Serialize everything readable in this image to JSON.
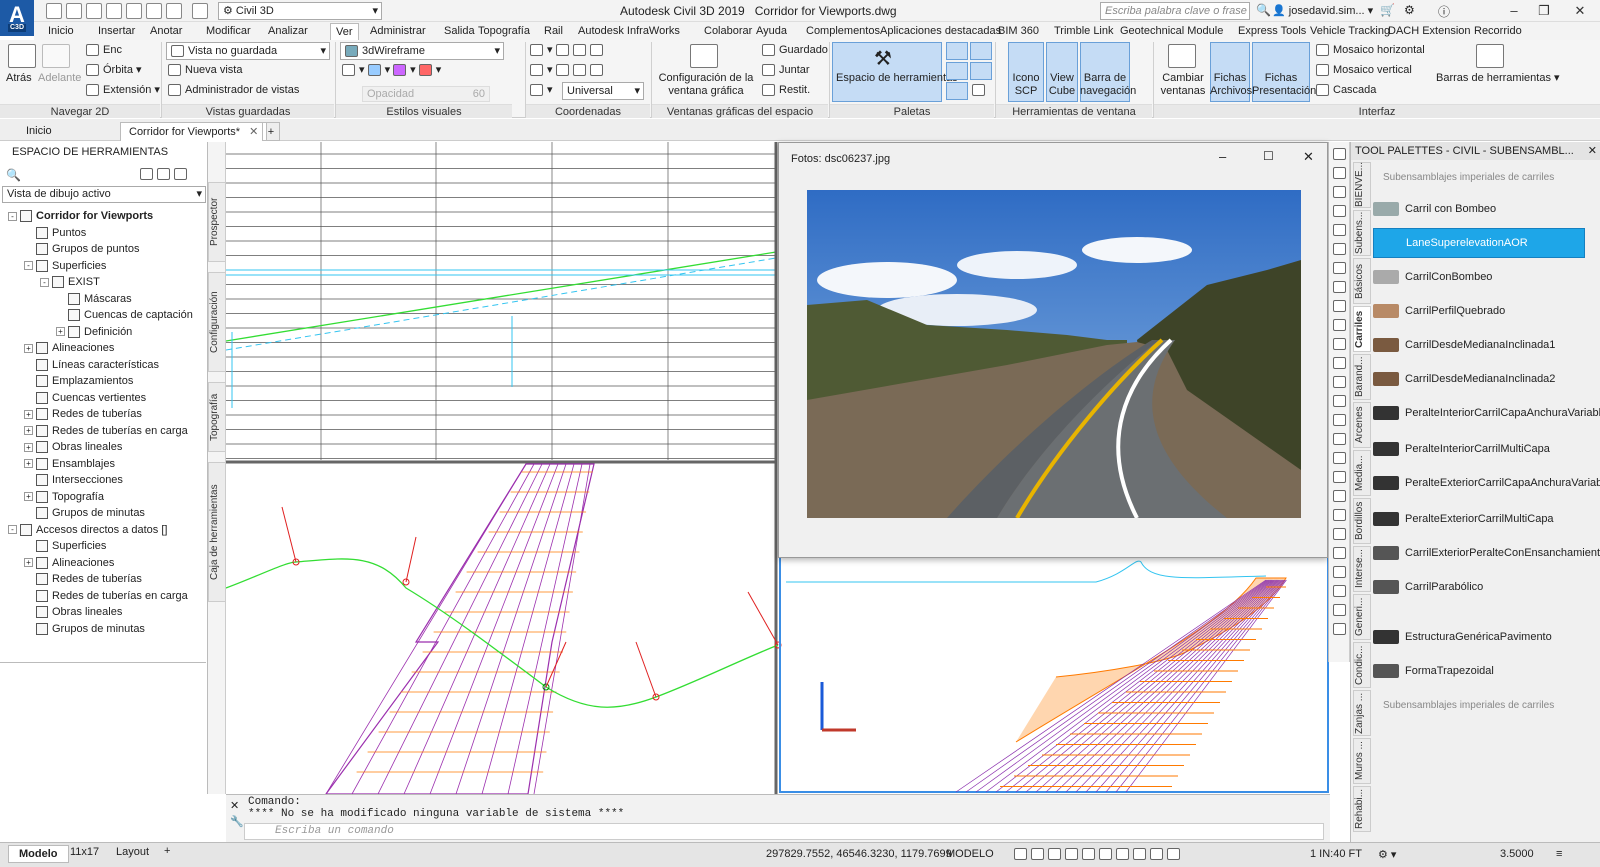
{
  "app": {
    "logo_text": "A",
    "logo_sub": "C3D",
    "title": "Autodesk Civil 3D 2019",
    "file": "Corridor for Viewports.dwg",
    "workspace": "Civil 3D",
    "search_placeholder": "Escriba palabra clave o frase",
    "user": "josedavid.sim..."
  },
  "ribbon_tabs": [
    "Inicio",
    "Insertar",
    "Anotar",
    "Modificar",
    "Analizar",
    "Ver",
    "Administrar",
    "Salida",
    "Topografía",
    "Rail",
    "Autodesk InfraWorks",
    "Colaborar",
    "Ayuda",
    "Complementos",
    "Aplicaciones destacadas",
    "BIM 360",
    "Trimble Link",
    "Geotechnical Module",
    "Express Tools",
    "Vehicle Tracking",
    "DACH Extension",
    "Recorrido"
  ],
  "active_tab": "Ver",
  "ribbon": {
    "nav": {
      "atras": "Atrás",
      "adelante": "Adelante",
      "enc": "Enc",
      "orbita": "Órbita",
      "extension": "Extensión",
      "title": "Navegar 2D"
    },
    "views": {
      "dropdown": "Vista no guardada",
      "nueva": "Nueva vista",
      "admin": "Administrador de vistas",
      "title": "Vistas guardadas"
    },
    "visual": {
      "dropdown": "3dWireframe",
      "opacity_label": "Opacidad",
      "opacity_value": "60",
      "title": "Estilos visuales"
    },
    "coords": {
      "dropdown": "Universal",
      "title": "Coordenadas"
    },
    "viewports": {
      "config": "Configuración de la ventana gráfica",
      "guardado": "Guardado",
      "juntar": "Juntar",
      "restit": "Restit.",
      "title": "Ventanas gráficas del espacio modelo"
    },
    "palettes": {
      "tool": "Espacio de herramientas",
      "title": "Paletas"
    },
    "vptools": {
      "icono": "Icono SCP",
      "viewcube": "View Cube",
      "barra": "Barra de navegación",
      "title": "Herramientas de ventana gráfica"
    },
    "interface": {
      "cambiar": "Cambiar ventanas",
      "fichas_arch": "Fichas Archivos",
      "fichas_pres": "Fichas Presentación",
      "mosaico_h": "Mosaico horizontal",
      "mosaico_v": "Mosaico vertical",
      "cascada": "Cascada",
      "barras": "Barras de herramientas",
      "title": "Interfaz"
    }
  },
  "doc_tabs": [
    "Inicio",
    "Corridor for Viewports*"
  ],
  "prospector": {
    "title": "ESPACIO DE HERRAMIENTAS",
    "view": "Vista de dibujo activo",
    "tree": [
      {
        "label": "Corridor for Viewports",
        "level": 0,
        "exp": "-",
        "bold": true
      },
      {
        "label": "Puntos",
        "level": 1
      },
      {
        "label": "Grupos de puntos",
        "level": 1
      },
      {
        "label": "Superficies",
        "level": 1,
        "exp": "-"
      },
      {
        "label": "EXIST",
        "level": 2,
        "exp": "-"
      },
      {
        "label": "Máscaras",
        "level": 3
      },
      {
        "label": "Cuencas de captación",
        "level": 3
      },
      {
        "label": "Definición",
        "level": 3,
        "exp": "+"
      },
      {
        "label": "Alineaciones",
        "level": 1,
        "exp": "+"
      },
      {
        "label": "Líneas características",
        "level": 1
      },
      {
        "label": "Emplazamientos",
        "level": 1
      },
      {
        "label": "Cuencas vertientes",
        "level": 1
      },
      {
        "label": "Redes de tuberías",
        "level": 1,
        "exp": "+"
      },
      {
        "label": "Redes de tuberías en carga",
        "level": 1,
        "exp": "+"
      },
      {
        "label": "Obras lineales",
        "level": 1,
        "exp": "+"
      },
      {
        "label": "Ensamblajes",
        "level": 1,
        "exp": "+"
      },
      {
        "label": "Intersecciones",
        "level": 1
      },
      {
        "label": "Topografía",
        "level": 1,
        "exp": "+"
      },
      {
        "label": "Grupos de minutas",
        "level": 1
      },
      {
        "label": "Accesos directos a datos []",
        "level": 0,
        "exp": "-"
      },
      {
        "label": "Superficies",
        "level": 1
      },
      {
        "label": "Alineaciones",
        "level": 1,
        "exp": "+"
      },
      {
        "label": "Redes de tuberías",
        "level": 1
      },
      {
        "label": "Redes de tuberías en carga",
        "level": 1
      },
      {
        "label": "Obras lineales",
        "level": 1
      },
      {
        "label": "Grupos de minutas",
        "level": 1
      }
    ],
    "side_tabs": [
      "Prospector",
      "Configuración",
      "Topografía",
      "Caja de herramientas"
    ]
  },
  "photo_window": {
    "title": "Fotos: dsc06237.jpg"
  },
  "tool_palette": {
    "title": "TOOL PALETTES - CIVIL - SUBENSAMBL...",
    "header": "Subensamblajes imperiales de carriles",
    "footer": "Subensamblajes imperiales de carriles",
    "items": [
      "Carril con Bombeo",
      "LaneSuperelevationAOR",
      "CarrilConBombeo",
      "CarrilPerfilQuebrado",
      "CarrilDesdeMedianaInclinada1",
      "CarrilDesdeMedianaInclinada2",
      "PeralteInteriorCarrilCapaAnchuraVariable",
      "PeralteInteriorCarrilMultiCapa",
      "PeralteExteriorCarrilCapaAnchuraVariable",
      "PeralteExteriorCarrilMultiCapa",
      "CarrilExteriorPeralteConEnsanchamiento",
      "CarrilParabólico",
      "EstructuraGenéricaPavimento",
      "FormaTrapezoidal"
    ],
    "side_tabs": [
      "BIENVE...",
      "Subens...",
      "Básicos",
      "Carriles",
      "Barand...",
      "Arcenes",
      "Media...",
      "Bordillos",
      "Interse...",
      "Generi...",
      "Condic...",
      "Zanjas ...",
      "Muros ...",
      "Rehabi..."
    ]
  },
  "command": {
    "label": "Comando:",
    "history": "**** No se ha modificado ninguna variable de sistema ****",
    "placeholder": "Escriba un comando"
  },
  "layout_tabs": [
    "Modelo",
    "11x17",
    "Layout"
  ],
  "status": {
    "coords": "297829.7552, 46546.3230, 1179.7699",
    "mode": "MODELO",
    "scale": "1 IN:40 FT",
    "value": "3.5000"
  },
  "colors": {
    "accent": "#1ea6e8",
    "green": "#33dd33",
    "cyan": "#33c4f0",
    "red": "#e02020",
    "magenta": "#9b2fae",
    "orange": "#ff7a00"
  }
}
